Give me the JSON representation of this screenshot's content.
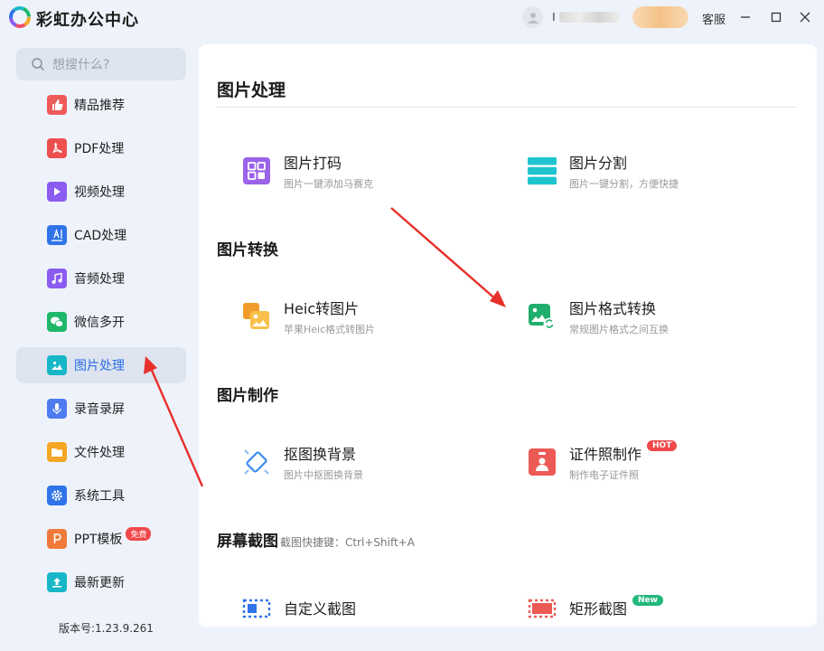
{
  "app": {
    "title": "彩虹办公中心",
    "user_id_prefix": "I",
    "support_label": "客服"
  },
  "sidebar": {
    "search_placeholder": "想搜什么?",
    "items": [
      {
        "label": "精品推荐",
        "icon": "thumbs-up-icon",
        "color": "#ee5a5a"
      },
      {
        "label": "PDF处理",
        "icon": "pdf-icon",
        "color": "#ee5050"
      },
      {
        "label": "视频处理",
        "icon": "video-play-icon",
        "color": "#8a5cf0"
      },
      {
        "label": "CAD处理",
        "icon": "cad-icon",
        "color": "#2f74e8"
      },
      {
        "label": "音频处理",
        "icon": "music-note-icon",
        "color": "#8a5cf0"
      },
      {
        "label": "微信多开",
        "icon": "wechat-icon",
        "color": "#1fb86a"
      },
      {
        "label": "图片处理",
        "icon": "image-icon",
        "color": "#17b7c7"
      },
      {
        "label": "录音录屏",
        "icon": "microphone-icon",
        "color": "#4e7cf0"
      },
      {
        "label": "文件处理",
        "icon": "folder-icon",
        "color": "#f5a623"
      },
      {
        "label": "系统工具",
        "icon": "gear-icon",
        "color": "#2f74e8"
      },
      {
        "label": "PPT模板",
        "icon": "ppt-icon",
        "color": "#f07a3a",
        "badge": "免费"
      },
      {
        "label": "最新更新",
        "icon": "upload-icon",
        "color": "#17b7c7"
      }
    ],
    "active_index": 6,
    "version": "版本号:1.23.9.261"
  },
  "main": {
    "title": "图片处理",
    "sections": [
      {
        "title": "图片转换"
      },
      {
        "title": "图片制作"
      },
      {
        "title": "屏幕截图",
        "hint": "截图快捷键：Ctrl+Shift+A"
      }
    ],
    "tools": {
      "mosaic": {
        "name": "图片打码",
        "desc": "图片一键添加马赛克"
      },
      "split": {
        "name": "图片分割",
        "desc": "图片一键分割，方便快捷"
      },
      "heic": {
        "name": "Heic转图片",
        "desc": "苹果Heic格式转图片"
      },
      "format": {
        "name": "图片格式转换",
        "desc": "常规图片格式之间互换"
      },
      "cutout": {
        "name": "抠图换背景",
        "desc": "图片中抠图换背景"
      },
      "idphoto": {
        "name": "证件照制作",
        "desc": "制作电子证件照",
        "tag": "HOT"
      },
      "custom_shot": {
        "name": "自定义截图"
      },
      "rect_shot": {
        "name": "矩形截图",
        "tag": "New"
      }
    }
  },
  "colors": {
    "accent": "#2a6de8",
    "arrow": "#e8302a"
  }
}
